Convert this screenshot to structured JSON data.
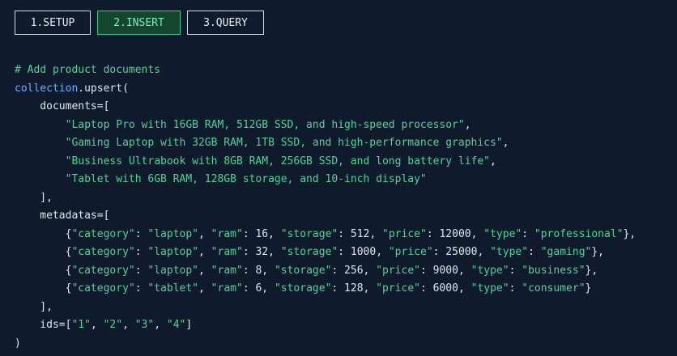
{
  "tabs": [
    {
      "label": "1.SETUP",
      "active": false
    },
    {
      "label": "2.INSERT",
      "active": true
    },
    {
      "label": "3.QUERY",
      "active": false
    }
  ],
  "code": {
    "comment": "# Add product documents",
    "call_object": "collection",
    "call_method": ".upsert(",
    "documents_open": "    documents=[",
    "documents": [
      "\"Laptop Pro with 16GB RAM, 512GB SSD, and high-speed processor\"",
      "\"Gaming Laptop with 32GB RAM, 1TB SSD, and high-performance graphics\"",
      "\"Business Ultrabook with 8GB RAM, 256GB SSD, and long battery life\"",
      "\"Tablet with 6GB RAM, 128GB storage, and 10-inch display\""
    ],
    "documents_seps": [
      ",",
      ",",
      ",",
      ""
    ],
    "list_close": "    ],",
    "metadatas_open": "    metadatas=[",
    "metadatas": [
      [
        "{",
        "\"category\"",
        ": ",
        "\"laptop\"",
        ", ",
        "\"ram\"",
        ": 16, ",
        "\"storage\"",
        ": 512, ",
        "\"price\"",
        ": 12000, ",
        "\"type\"",
        ": ",
        "\"professional\"",
        "},"
      ],
      [
        "{",
        "\"category\"",
        ": ",
        "\"laptop\"",
        ", ",
        "\"ram\"",
        ": 32, ",
        "\"storage\"",
        ": 1000, ",
        "\"price\"",
        ": 25000, ",
        "\"type\"",
        ": ",
        "\"gaming\"",
        "},"
      ],
      [
        "{",
        "\"category\"",
        ": ",
        "\"laptop\"",
        ", ",
        "\"ram\"",
        ": 8, ",
        "\"storage\"",
        ": 256, ",
        "\"price\"",
        ": 9000, ",
        "\"type\"",
        ": ",
        "\"business\"",
        "},"
      ],
      [
        "{",
        "\"category\"",
        ": ",
        "\"tablet\"",
        ", ",
        "\"ram\"",
        ": 6, ",
        "\"storage\"",
        ": 128, ",
        "\"price\"",
        ": 6000, ",
        "\"type\"",
        ": ",
        "\"consumer\"",
        "}"
      ]
    ],
    "ids_prefix": "    ids=[",
    "ids": [
      "\"1\"",
      "\"2\"",
      "\"3\"",
      "\"4\""
    ],
    "ids_suffix": "]",
    "call_close": ")"
  },
  "colors": {
    "background": "#0f1b2d",
    "accent_green": "#52d39a",
    "identifier_blue": "#6fb0ff",
    "plain_text": "#dfe7f0"
  }
}
